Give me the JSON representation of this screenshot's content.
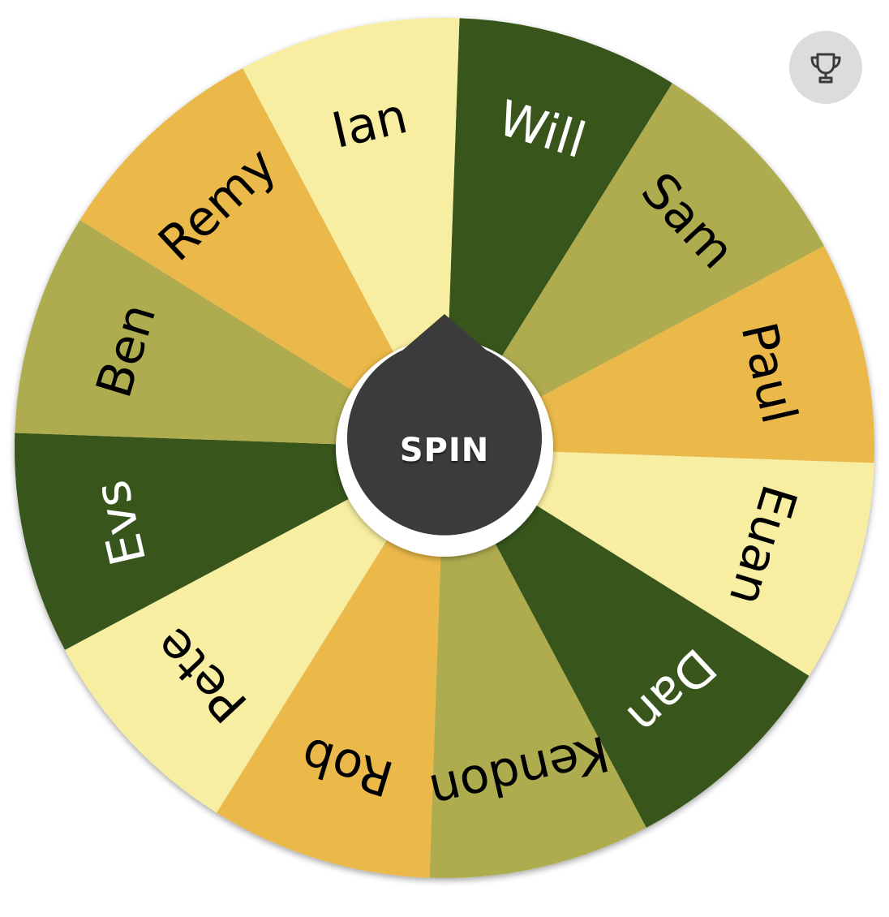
{
  "wheel": {
    "start_angle_deg": -88,
    "slices": [
      {
        "label": "Will",
        "color": "#39561d",
        "text_color": "#ffffff"
      },
      {
        "label": "Sam",
        "color": "#afac50",
        "text_color": "#000000"
      },
      {
        "label": "Paul",
        "color": "#ebb948",
        "text_color": "#000000"
      },
      {
        "label": "Euan",
        "color": "#f8eea1",
        "text_color": "#000000"
      },
      {
        "label": "Dan",
        "color": "#39561d",
        "text_color": "#ffffff"
      },
      {
        "label": "Kendon",
        "color": "#afac50",
        "text_color": "#000000"
      },
      {
        "label": "Rob",
        "color": "#ebb948",
        "text_color": "#000000"
      },
      {
        "label": "Pete",
        "color": "#f8eea1",
        "text_color": "#000000"
      },
      {
        "label": "Evs",
        "color": "#39561d",
        "text_color": "#ffffff"
      },
      {
        "label": "Ben",
        "color": "#afac50",
        "text_color": "#000000"
      },
      {
        "label": "Remy",
        "color": "#ebb948",
        "text_color": "#000000"
      },
      {
        "label": "Ian",
        "color": "#f8eea1",
        "text_color": "#000000"
      }
    ]
  },
  "spin_button": {
    "label": "SPIN",
    "color": "#3b3b3b",
    "ring_color": "#ffffff",
    "text_color": "#ffffff"
  },
  "trophy_button": {
    "icon": "trophy-icon",
    "background": "#dcdcdc",
    "icon_color": "#3a3a3a"
  }
}
